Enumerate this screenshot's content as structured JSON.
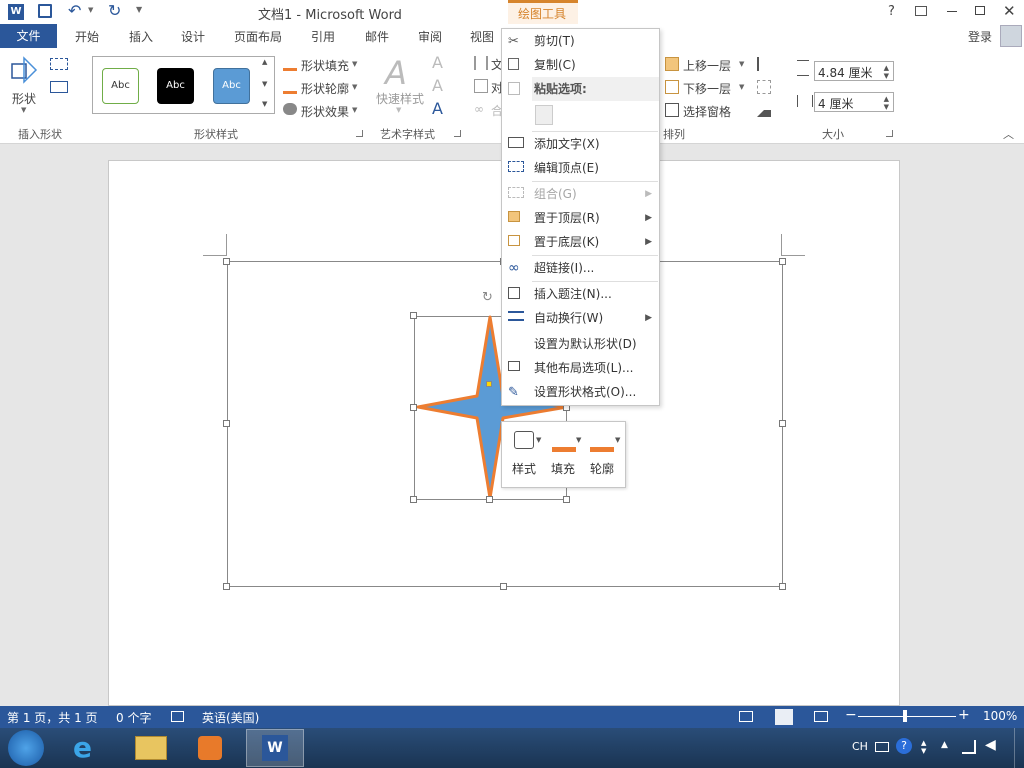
{
  "title": {
    "doc": "文档1 - Microsoft Word",
    "tools": "绘图工具",
    "help": "?"
  },
  "tabs": {
    "file": "文件",
    "home": "开始",
    "insert": "插入",
    "design": "设计",
    "layout": "页面布局",
    "references": "引用",
    "mailings": "邮件",
    "review": "审阅",
    "view": "视图",
    "login": "登录"
  },
  "ribbon": {
    "shape_label": "形状",
    "insert_shapes": "插入形状",
    "styles": [
      "Abc",
      "Abc",
      "Abc"
    ],
    "fill": "形状填充",
    "outline": "形状轮廓",
    "effects": "形状效果",
    "shape_styles": "形状样式",
    "quick_styles": "快速样式",
    "art_styles": "艺术字样式",
    "text_partial": "文",
    "align_partial": "对",
    "combine_partial": "合",
    "bring_forward": "上移一层",
    "send_backward": "下移一层",
    "selection_pane": "选择窗格",
    "arrange": "排列",
    "height": "4.84 厘米",
    "width": "4 厘米",
    "size": "大小"
  },
  "menu": {
    "cut": "剪切(T)",
    "copy": "复制(C)",
    "paste_options": "粘贴选项:",
    "add_text": "添加文字(X)",
    "edit_points": "编辑顶点(E)",
    "group": "组合(G)",
    "bring_front": "置于顶层(R)",
    "send_back": "置于底层(K)",
    "hyperlink": "超链接(I)...",
    "caption": "插入题注(N)...",
    "wrap": "自动换行(W)",
    "default_shape": "设置为默认形状(D)",
    "layout_options": "其他布局选项(L)...",
    "format_shape": "设置形状格式(O)..."
  },
  "mini": {
    "style": "样式",
    "fill": "填充",
    "outline": "轮廓"
  },
  "status": {
    "page": "第 1 页，共 1 页",
    "words": "0 个字",
    "lang": "英语(美国)",
    "zoom": "100%"
  },
  "taskbar": {
    "ime": "CH"
  },
  "colors": {
    "accent": "#2b579a",
    "tools": "#d6842c",
    "star_fill": "#5b9bd5",
    "star_stroke": "#ed7d31"
  }
}
